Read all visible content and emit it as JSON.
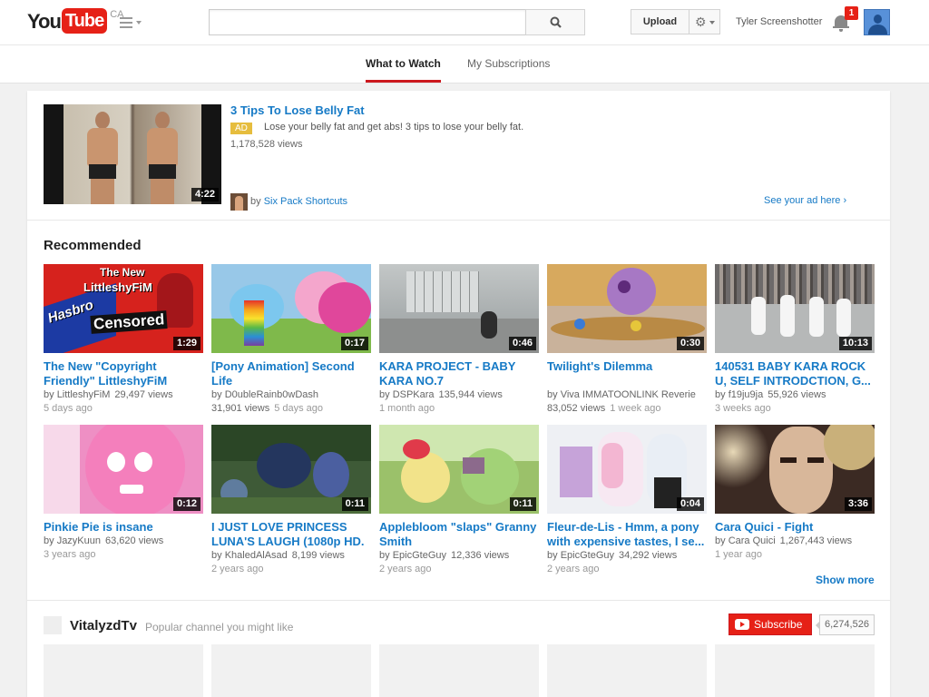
{
  "masthead": {
    "logo_you": "You",
    "logo_tube": "Tube",
    "logo_region": "CA",
    "search_placeholder": "",
    "upload_label": "Upload",
    "username": "Tyler Screenshotter",
    "notification_count": "1"
  },
  "tabs": [
    {
      "label": "What to Watch",
      "active": true
    },
    {
      "label": "My Subscriptions",
      "active": false
    }
  ],
  "ad": {
    "title": "3 Tips To Lose Belly Fat",
    "badge": "AD",
    "description": "Lose your belly fat and get abs! 3 tips to lose your belly fat.",
    "views": "1,178,528 views",
    "duration": "4:22",
    "by_prefix": "by",
    "channel": "Six Pack Shortcuts",
    "see_your_ad": "See your ad here ›"
  },
  "recommended": {
    "title": "Recommended",
    "show_more": "Show more",
    "videos": [
      {
        "title": "The New \"Copyright Friendly\" LittleshyFiM",
        "channel": "LittleshyFiM",
        "views": "29,497 views",
        "age": "5 days ago",
        "duration": "1:29",
        "age_inline": false
      },
      {
        "title": "[Pony Animation] Second Life",
        "channel": "D0ubleRainb0wDash",
        "views": "31,901 views",
        "age": "5 days ago",
        "duration": "0:17",
        "age_inline": true
      },
      {
        "title": "KARA PROJECT - BABY KARA NO.7",
        "channel": "DSPKara",
        "views": "135,944 views",
        "age": "1 month ago",
        "duration": "0:46",
        "age_inline": false
      },
      {
        "title": "Twilight's Dilemma",
        "channel": "Viva IMMATOONLINK Reverie",
        "views": "83,052 views",
        "age": "1 week ago",
        "duration": "0:30",
        "age_inline": true
      },
      {
        "title": "140531 BABY KARA ROCK U, SELF INTRODCTION, G...",
        "channel": "f19ju9ja",
        "views": "55,926 views",
        "age": "3 weeks ago",
        "duration": "10:13",
        "age_inline": false
      },
      {
        "title": "Pinkie Pie is insane",
        "channel": "JazyKuun",
        "views": "63,620 views",
        "age": "3 years ago",
        "duration": "0:12",
        "age_inline": false
      },
      {
        "title": "I JUST LOVE PRINCESS LUNA'S LAUGH (1080p HD.",
        "channel": "KhaledAlAsad",
        "views": "8,199 views",
        "age": "2 years ago",
        "duration": "0:11",
        "age_inline": false
      },
      {
        "title": "Applebloom \"slaps\" Granny Smith",
        "channel": "EpicGteGuy",
        "views": "12,336 views",
        "age": "2 years ago",
        "duration": "0:11",
        "age_inline": false
      },
      {
        "title": "Fleur-de-Lis - Hmm, a pony with expensive tastes, I se...",
        "channel": "EpicGteGuy",
        "views": "34,292 views",
        "age": "2 years ago",
        "duration": "0:04",
        "age_inline": false
      },
      {
        "title": "Cara Quici - Fight",
        "channel": "Cara Quici",
        "views": "1,267,443 views",
        "age": "1 year ago",
        "duration": "3:36",
        "age_inline": false
      }
    ]
  },
  "thumb_text": {
    "t1_line1": "The New",
    "t1_line2": "LittleshyFiM",
    "t1_brand": "Hasbro",
    "t1_censored": "Censored"
  },
  "channel_section": {
    "name": "VitalyzdTv",
    "subtitle": "Popular channel you might like",
    "subscribe_label": "Subscribe",
    "subscriber_count": "6,274,526"
  },
  "colors": {
    "brand_red": "#e62117",
    "link_blue": "#167ac6",
    "ad_badge": "#e6bd3e"
  },
  "icons": {
    "guide": "hamburger-icon",
    "search": "search-icon",
    "settings": "gear-icon",
    "notifications": "bell-icon"
  }
}
